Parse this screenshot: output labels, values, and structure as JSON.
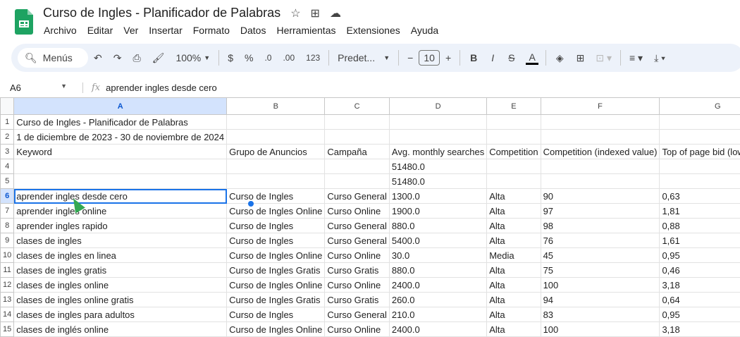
{
  "app": {
    "title": "Curso de Ingles - Planificador de Palabras"
  },
  "menu": [
    "Archivo",
    "Editar",
    "Ver",
    "Insertar",
    "Formato",
    "Datos",
    "Herramientas",
    "Extensiones",
    "Ayuda"
  ],
  "toolbar": {
    "search": "Menús",
    "zoom": "100%",
    "currency": "$",
    "percent": "%",
    "dec_less": ".0",
    "dec_more": ".00",
    "num_format": "123",
    "font": "Predet...",
    "font_size": "10",
    "bold": "B",
    "italic": "I",
    "text_color": "A"
  },
  "formula_bar": {
    "cell_ref": "A6",
    "fx": "fx",
    "value": "aprender ingles desde cero"
  },
  "columns": [
    "A",
    "B",
    "C",
    "D",
    "E",
    "F",
    "G"
  ],
  "rows": [
    [
      "Curso de Ingles - Planificador de Palabras",
      "",
      "",
      "",
      "",
      "",
      ""
    ],
    [
      "1 de diciembre de 2023 - 30 de noviembre de 2024",
      "",
      "",
      "",
      "",
      "",
      ""
    ],
    [
      "Keyword",
      "Grupo de Anuncios",
      "Campaña",
      "Avg. monthly searches",
      "Competition",
      "Competition (indexed value)",
      "Top of page bid (low range)"
    ],
    [
      "",
      "",
      "",
      "51480.0",
      "",
      "",
      ""
    ],
    [
      "",
      "",
      "",
      "51480.0",
      "",
      "",
      ""
    ],
    [
      "aprender ingles desde cero",
      "Curso de Ingles",
      "Curso General",
      "1300.0",
      "Alta",
      "90",
      "0,63"
    ],
    [
      "aprender ingles online",
      "Curso de Ingles Online",
      "Curso Online",
      "1900.0",
      "Alta",
      "97",
      "1,81"
    ],
    [
      "aprender ingles rapido",
      "Curso de Ingles",
      "Curso General",
      "880.0",
      "Alta",
      "98",
      "0,88"
    ],
    [
      "clases de ingles",
      "Curso de Ingles",
      "Curso General",
      "5400.0",
      "Alta",
      "76",
      "1,61"
    ],
    [
      "clases de ingles en linea",
      "Curso de Ingles Online",
      "Curso Online",
      "30.0",
      "Media",
      "45",
      "0,95"
    ],
    [
      "clases de ingles gratis",
      "Curso de Ingles Gratis",
      "Curso Gratis",
      "880.0",
      "Alta",
      "75",
      "0,46"
    ],
    [
      "clases de ingles online",
      "Curso de Ingles Online",
      "Curso Online",
      "2400.0",
      "Alta",
      "100",
      "3,18"
    ],
    [
      "clases de ingles online gratis",
      "Curso de Ingles Gratis",
      "Curso Gratis",
      "260.0",
      "Alta",
      "94",
      "0,64"
    ],
    [
      "clases de ingles para adultos",
      "Curso de Ingles",
      "Curso General",
      "210.0",
      "Alta",
      "83",
      "0,95"
    ],
    [
      "clases de inglés online",
      "Curso de Ingles Online",
      "Curso Online",
      "2400.0",
      "Alta",
      "100",
      "3,18"
    ]
  ]
}
